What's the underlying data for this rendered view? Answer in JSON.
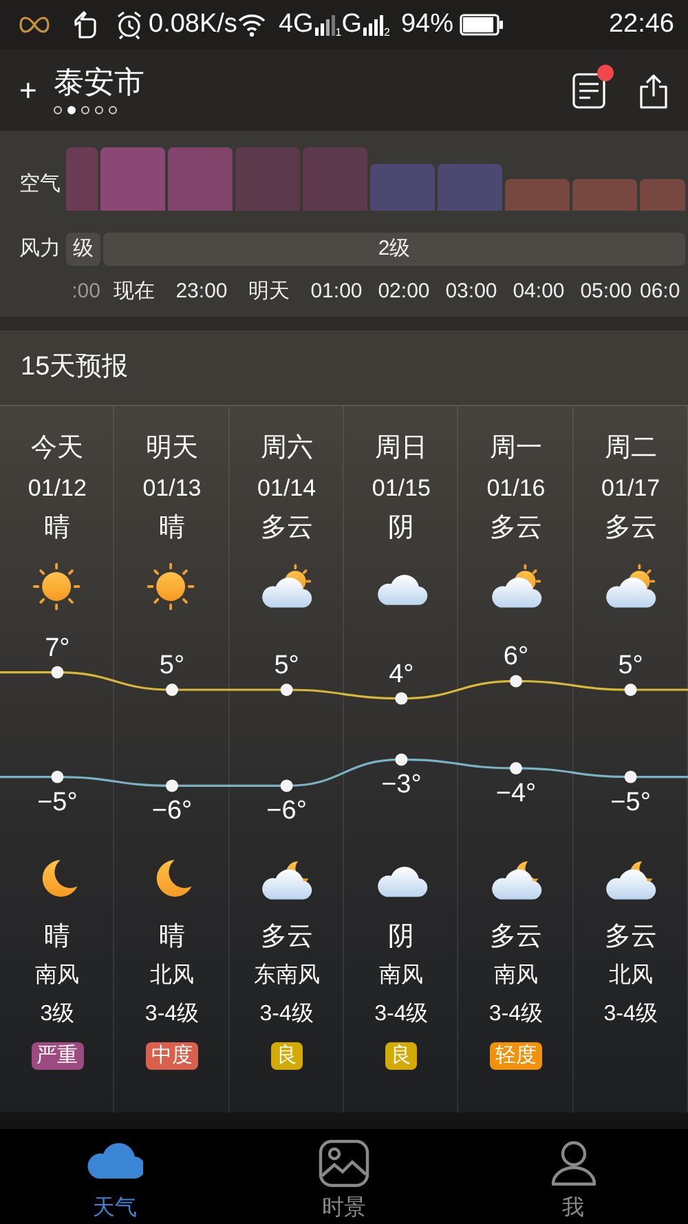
{
  "status_bar": {
    "speed": "0.08K/s",
    "net1": "4G",
    "sim1": "1",
    "net2": "G",
    "sim2": "2",
    "battery_text": "94%",
    "time": "22:46"
  },
  "header": {
    "add": "+",
    "city": "泰安市",
    "pages": [
      {
        "selected": false
      },
      {
        "selected": true
      },
      {
        "selected": false
      },
      {
        "selected": false
      },
      {
        "selected": false
      }
    ],
    "unread": true
  },
  "hourly": {
    "air_label": "空气",
    "wind_label": "风力",
    "hours": [
      {
        "time": ":00",
        "kind": "high",
        "color": "#6a3c54"
      },
      {
        "time": "现在",
        "kind": "high",
        "color": "#8c4874"
      },
      {
        "time": "23:00",
        "kind": "high",
        "color": "#81456b"
      },
      {
        "time": "明天",
        "kind": "high",
        "color": "#5d3a4b"
      },
      {
        "time": "01:00",
        "kind": "high",
        "color": "#5d3a4b"
      },
      {
        "time": "02:00",
        "kind": "medium",
        "color": "#4c4872"
      },
      {
        "time": "03:00",
        "kind": "medium",
        "color": "#4c4872"
      },
      {
        "time": "04:00",
        "kind": "low",
        "color": "#774840"
      },
      {
        "time": "05:00",
        "kind": "low",
        "color": "#774840"
      },
      {
        "time": "06:0",
        "kind": "low",
        "color": "#774840"
      }
    ],
    "wind": [
      {
        "label": "级"
      },
      {
        "label": "2级"
      }
    ]
  },
  "forecast": {
    "title": "15天预报",
    "days": [
      {
        "name": "今天",
        "date": "01/12",
        "day": {
          "kind": "sun",
          "weather": "晴"
        },
        "high": "7°",
        "low": "−5°",
        "night": {
          "kind": "moon",
          "weather": "晴"
        },
        "wind_dir": "南风",
        "wind_level": "3级",
        "aqi": {
          "text": "严重",
          "color": "#9c4a80"
        }
      },
      {
        "name": "明天",
        "date": "01/13",
        "day": {
          "kind": "sun",
          "weather": "晴"
        },
        "high": "5°",
        "low": "−6°",
        "night": {
          "kind": "moon",
          "weather": "晴"
        },
        "wind_dir": "北风",
        "wind_level": "3-4级",
        "aqi": {
          "text": "中度",
          "color": "#d9604c"
        }
      },
      {
        "name": "周六",
        "date": "01/14",
        "day": {
          "kind": "sun-cloud",
          "weather": "多云"
        },
        "high": "5°",
        "low": "−6°",
        "night": {
          "kind": "moon-cloud",
          "weather": "多云"
        },
        "wind_dir": "东南风",
        "wind_level": "3-4级",
        "aqi": {
          "text": "良",
          "color": "#d4aa06"
        }
      },
      {
        "name": "周日",
        "date": "01/15",
        "day": {
          "kind": "cloud",
          "weather": "阴"
        },
        "high": "4°",
        "low": "−3°",
        "night": {
          "kind": "cloud",
          "weather": "阴"
        },
        "wind_dir": "南风",
        "wind_level": "3-4级",
        "aqi": {
          "text": "良",
          "color": "#d4aa06"
        }
      },
      {
        "name": "周一",
        "date": "01/16",
        "day": {
          "kind": "sun-cloud",
          "weather": "多云"
        },
        "high": "6°",
        "low": "−4°",
        "night": {
          "kind": "moon-cloud",
          "weather": "多云"
        },
        "wind_dir": "南风",
        "wind_level": "3-4级",
        "aqi": {
          "text": "轻度",
          "color": "#f0920c"
        }
      },
      {
        "name": "周二",
        "date": "01/17",
        "day": {
          "kind": "sun-cloud",
          "weather": "多云"
        },
        "high": "5°",
        "low": "−5°",
        "night": {
          "kind": "moon-cloud",
          "weather": "多云"
        },
        "wind_dir": "北风",
        "wind_level": "3-4级"
      }
    ]
  },
  "tabs": [
    {
      "label": "天气",
      "selected": true
    },
    {
      "label": "时景",
      "selected": false
    },
    {
      "label": "我",
      "selected": false
    }
  ]
}
